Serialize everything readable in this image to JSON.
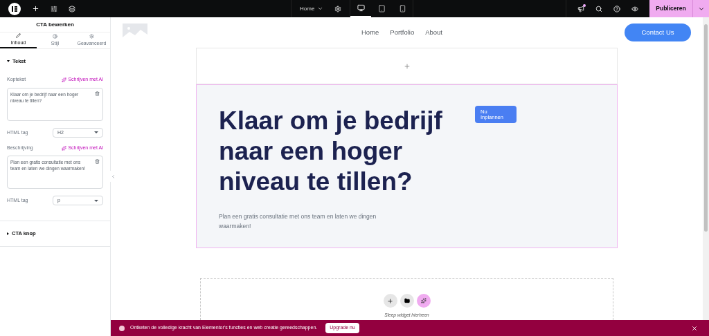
{
  "topbar": {
    "page_menu": "Home",
    "devices": [
      {
        "kind": "desktop",
        "selected": true
      },
      {
        "kind": "tablet",
        "selected": false
      },
      {
        "kind": "mobile",
        "selected": false
      }
    ],
    "publish": "Publiceren"
  },
  "panel": {
    "title": "CTA bewerken",
    "tabs": [
      {
        "label": "Inhoud",
        "selected": true
      },
      {
        "label": "Stijl",
        "selected": false
      },
      {
        "label": "Geavanceerd",
        "selected": false
      }
    ],
    "sections": [
      {
        "title": "Tekst",
        "expanded": true,
        "fields": [
          {
            "kind": "textarea",
            "label": "Koptekst",
            "ai": "Schrijven met AI",
            "value": "Klaar om je bedrijf naar een hoger niveau te tillen?"
          },
          {
            "kind": "select",
            "label": "HTML tag",
            "value": "H2"
          },
          {
            "kind": "textarea",
            "label": "Beschrijving",
            "ai": "Schrijven met AI",
            "value": "Plan een gratis consultatie met ons team en laten we dingen waarmaken!"
          },
          {
            "kind": "select",
            "label": "HTML tag",
            "value": "p"
          }
        ]
      },
      {
        "title": "CTA knop",
        "expanded": false
      }
    ]
  },
  "site": {
    "nav": [
      "Home",
      "Portfolio",
      "About"
    ],
    "contact_button": "Contact Us",
    "cta": {
      "heading": "Klaar om je bedrijf naar een hoger niveau te tillen?",
      "description": "Plan een gratis consultatie met ons team en laten we dingen waarmaken!",
      "button": "Nu Inplannen"
    },
    "dropzone": {
      "hint": "Sleep widget hierheen"
    }
  },
  "banner": {
    "text": "Ontketen de volledige kracht van Elementor's functies en web creatie gereedschappen.",
    "button": "Upgrade nu"
  }
}
